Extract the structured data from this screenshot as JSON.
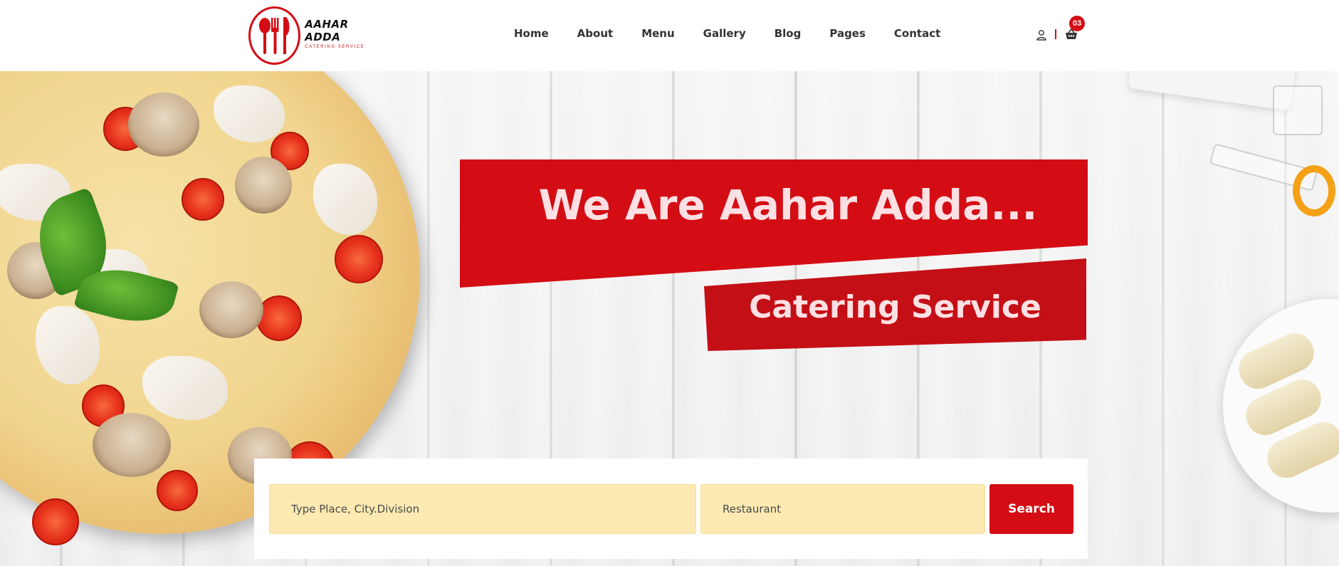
{
  "brand": {
    "name": "AAHAR ADDA",
    "tagline": "CATERING SERVICE"
  },
  "nav": {
    "items": [
      "Home",
      "About",
      "Menu",
      "Gallery",
      "Blog",
      "Pages",
      "Contact"
    ]
  },
  "header_actions": {
    "user_icon": "user-icon",
    "cart_icon": "basket-icon",
    "cart_count": "03"
  },
  "hero": {
    "headline": "We Are Aahar Adda...",
    "subheadline": "Catering Service"
  },
  "search": {
    "place_placeholder": "Type Place, City.Division",
    "category_value": "Restaurant",
    "button_label": "Search"
  },
  "colors": {
    "accent": "#d40c14",
    "input_bg": "#fdeab2"
  }
}
